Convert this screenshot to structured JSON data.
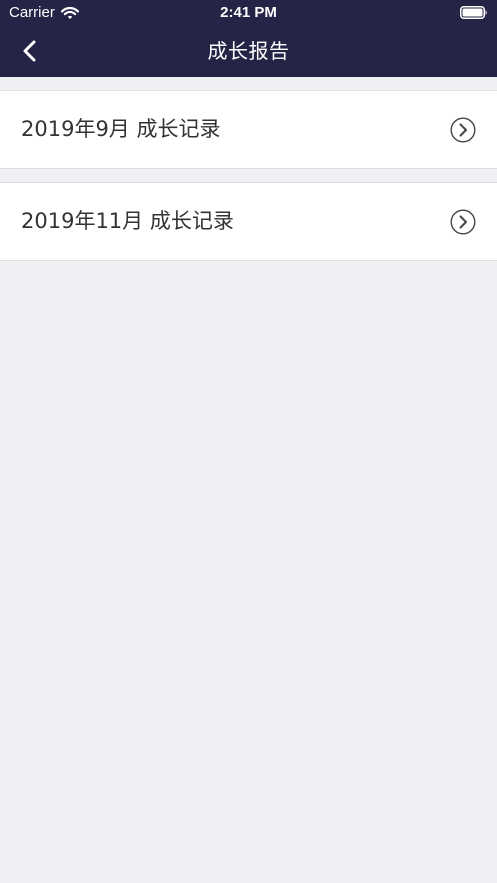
{
  "status_bar": {
    "carrier": "Carrier",
    "time": "2:41 PM",
    "wifi_icon": "wifi-icon",
    "battery_icon": "battery-full-icon"
  },
  "nav": {
    "back_icon": "chevron-left-icon",
    "title": "成长报告"
  },
  "colors": {
    "header_background": "#262446",
    "page_background": "#f0eff4",
    "row_background": "#ffffff",
    "row_text": "#333333",
    "row_divider": "#dedde2"
  },
  "reports": [
    {
      "label": "2019年9月 成长记录",
      "icon": "chevron-right-circle-icon"
    },
    {
      "label": "2019年11月 成长记录",
      "icon": "chevron-right-circle-icon"
    }
  ]
}
